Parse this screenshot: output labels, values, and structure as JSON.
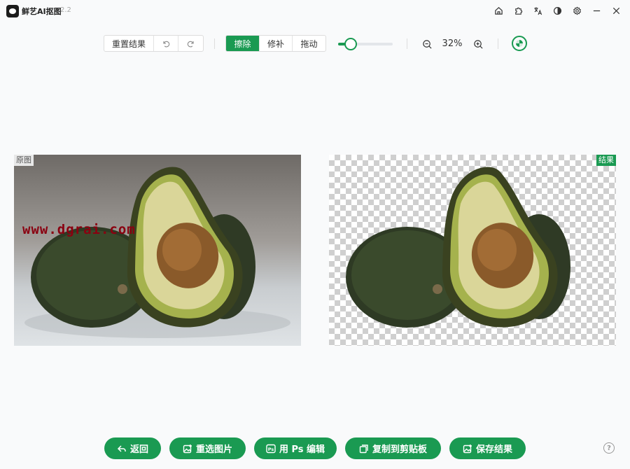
{
  "app": {
    "title": "鲜艺AI抠图",
    "version": "2.2"
  },
  "titlebar": {
    "icons": [
      "home-icon",
      "puzzle-icon",
      "translate-icon",
      "contrast-icon",
      "settings-icon",
      "minimize-icon",
      "close-icon"
    ]
  },
  "toolbar": {
    "reset_label": "重置结果",
    "undo_icon": "undo-icon",
    "redo_icon": "redo-icon",
    "modes": [
      {
        "label": "擦除",
        "active": true
      },
      {
        "label": "修补",
        "active": false
      },
      {
        "label": "拖动",
        "active": false
      }
    ],
    "brush_size_fraction": 0.15,
    "zoom_level": "32%"
  },
  "panels": {
    "original_label": "原图",
    "result_label": "结果",
    "watermark": "www.dgrai.com"
  },
  "actions": [
    {
      "label": "返回",
      "icon": "back-icon"
    },
    {
      "label": "重选图片",
      "icon": "image-add-icon"
    },
    {
      "label": "用 Ps 编辑",
      "icon": "ps-icon"
    },
    {
      "label": "复制到剪贴板",
      "icon": "copy-icon"
    },
    {
      "label": "保存结果",
      "icon": "save-image-icon"
    }
  ],
  "help_icon": "?",
  "colors": {
    "accent": "#1a9a52"
  }
}
